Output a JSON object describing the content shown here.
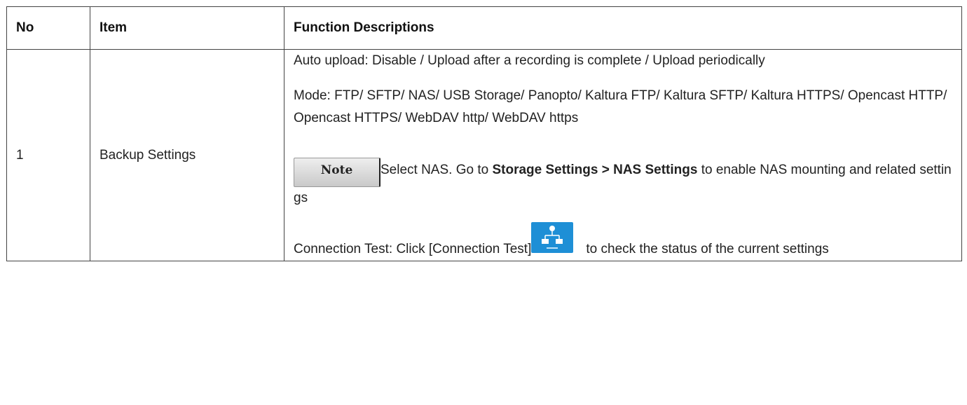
{
  "table": {
    "headers": [
      "No",
      "Item",
      "Function Descriptions"
    ],
    "rows": [
      {
        "no": "1",
        "item": "Backup Settings",
        "description": {
          "auto_upload": "Auto upload: Disable / Upload after a recording is complete / Upload periodically",
          "mode": "Mode: FTP/ SFTP/ NAS/ USB Storage/ Panopto/ Kaltura FTP/ Kaltura SFTP/ Kaltura HTTPS/ Opencast HTTP/ Opencast HTTPS/ WebDAV http/ WebDAV https",
          "note_label": "Note",
          "note_text_prefix": "Select NAS. Go to",
          "note_text_bold": "Storage Settings > NAS Settings",
          "note_text_suffix": "to enable NAS mounting and related settings",
          "connection_prefix": "Connection Test: Click [Connection Test]",
          "connection_suffix": "to check the status of the current settings",
          "connection_icon": "network-connection-icon"
        }
      }
    ]
  },
  "colors": {
    "border": "#444444",
    "icon_blue": "#1e8fd6"
  }
}
